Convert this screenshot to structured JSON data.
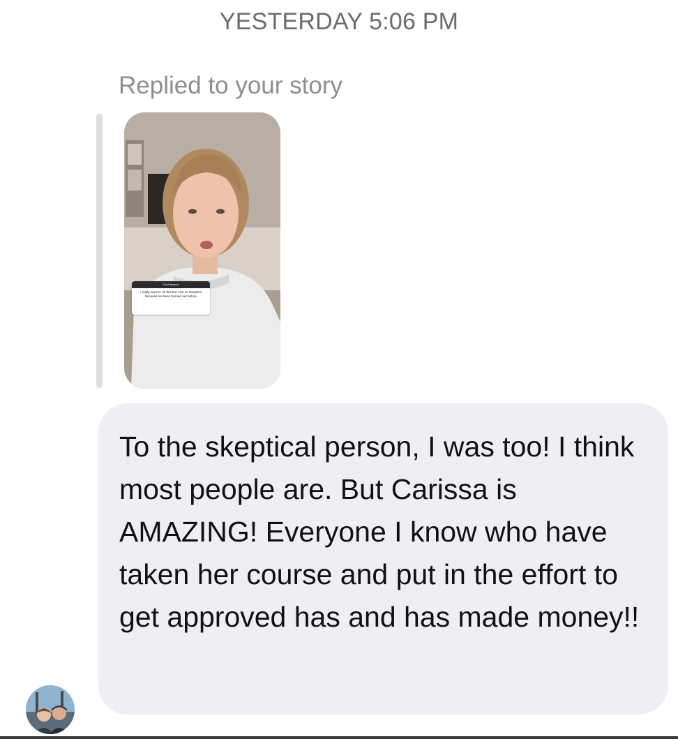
{
  "thread": {
    "timestamp": "YESTERDAY 5:06 PM"
  },
  "reply": {
    "label": "Replied to your story",
    "story_sticker": {
      "header": "Свой вопрос",
      "text": "I really want to do this but I am so skeptical because Ive been burned out before"
    }
  },
  "message": {
    "text": "To the skeptical person, I was too! I think most people are. But Carissa is AMAZING! Everyone I know who have taken her course and put in the effort to get approved has and has made money!!"
  },
  "sender": {
    "avatar": "sender-avatar-photo"
  },
  "colors": {
    "timestamp": "#6c6c70",
    "reply_label": "#8e8e93",
    "bubble": "#efeff3",
    "reply_bar": "#dedee2",
    "text": "#111111"
  }
}
